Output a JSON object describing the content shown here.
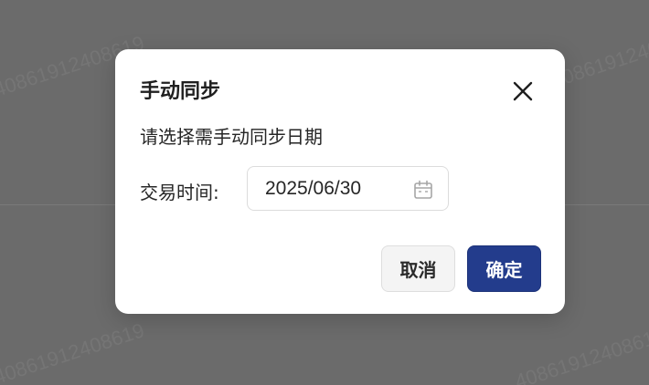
{
  "background": {
    "watermark_text": "40861912408619"
  },
  "dialog": {
    "title": "手动同步",
    "description": "请选择需手动同步日期",
    "field_label": "交易时间:",
    "date_value": "2025/06/30",
    "cancel_label": "取消",
    "confirm_label": "确定",
    "close_icon": "close-icon",
    "calendar_icon": "calendar-icon"
  },
  "colors": {
    "overlay": "#6b6b6b",
    "primary": "#233c8c",
    "cancel_bg": "#f4f4f4"
  }
}
